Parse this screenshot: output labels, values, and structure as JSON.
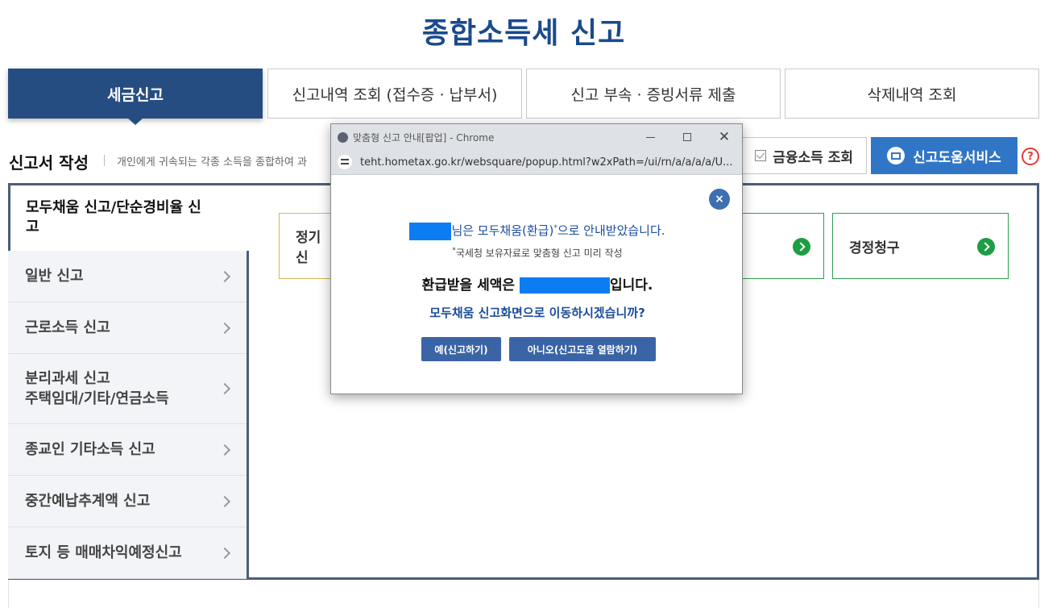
{
  "page": {
    "title": "종합소득세 신고"
  },
  "tabs": [
    {
      "label": "세금신고",
      "active": true
    },
    {
      "label": "신고내역 조회 (접수증 · 납부서)"
    },
    {
      "label": "신고 부속 · 증빙서류 제출"
    },
    {
      "label": "삭제내역 조회"
    }
  ],
  "section": {
    "title": "신고서 작성",
    "description": "개인에게 귀속되는 각종 소득을 종합하여 과",
    "fin_button": "금융소득 조회",
    "help_button": "신고도움서비스",
    "help_icon": "?"
  },
  "nav": {
    "active": "모두채움 신고/단순경비율 신고",
    "items": [
      {
        "label": "일반 신고"
      },
      {
        "label": "근로소득 신고"
      },
      {
        "label": "분리과세 신고\n주택임대/기타/연금소득"
      },
      {
        "label": "종교인 기타소득 신고"
      },
      {
        "label": "중간예납추계액 신고"
      },
      {
        "label": "토지 등 매매차익예정신고"
      }
    ]
  },
  "cards": [
    {
      "label": "정기신"
    },
    {
      "label": ""
    },
    {
      "label": "경정청구"
    }
  ],
  "popup": {
    "window_title": "맞춤형 신고 안내[팝업] - Chrome",
    "url": "teht.hometax.go.kr/websquare/popup.html?w2xPath=/ui/rn/a/a/a/a/U...",
    "line1_suffix": "님은 모두채움(환급)",
    "line1_sup": "*",
    "line1_end": "으로 안내받았습니다.",
    "line2_sup": "*",
    "line2": "국세청 보유자료로 맞춤형 신고 미리 작성",
    "line3_prefix": "환급받을 세액은 ",
    "line3_suffix": "입니다.",
    "line4": "모두채움 신고화면으로 이동하시겠습니까?",
    "yes_button": "예(신고하기)",
    "no_button": "아니오(신고도움 열람하기)",
    "close_icon": "×",
    "redact_color": "#0b7cf2"
  },
  "colors": {
    "primary": "#264d82",
    "accent": "#3176c6",
    "go": "#1f9d44"
  }
}
